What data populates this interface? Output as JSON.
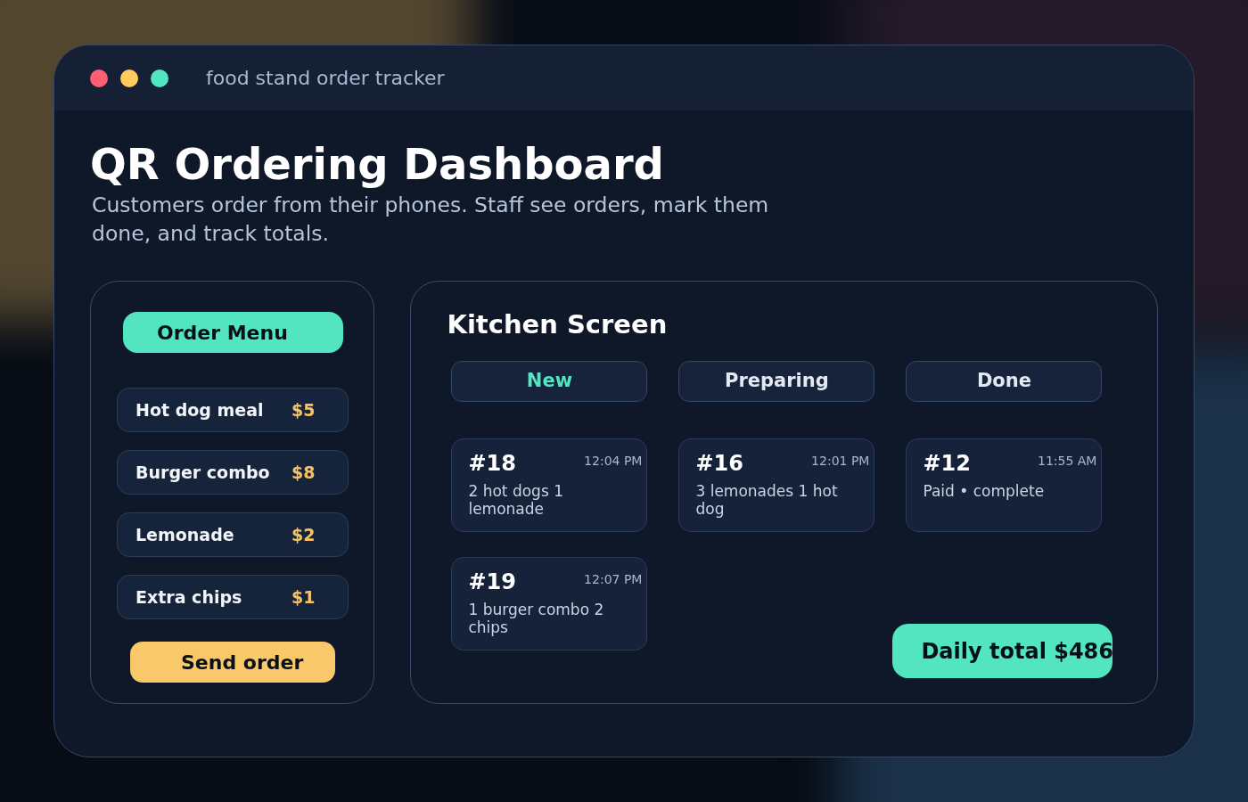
{
  "window": {
    "title": "food stand order tracker"
  },
  "header": {
    "title": "QR Ordering Dashboard",
    "subtitle": "Customers order from their phones. Staff see orders, mark them done, and track totals."
  },
  "order_menu": {
    "title": "Order Menu",
    "items": [
      {
        "name": "Hot dog meal",
        "price": "$5"
      },
      {
        "name": "Burger combo",
        "price": "$8"
      },
      {
        "name": "Lemonade",
        "price": "$2"
      },
      {
        "name": "Extra chips",
        "price": "$1"
      }
    ],
    "button": "Send order"
  },
  "kitchen": {
    "title": "Kitchen Screen",
    "columns": [
      {
        "label": "New",
        "selected": true,
        "orders": [
          {
            "number": "#18",
            "time": "12:04 PM",
            "details": "2 hot dogs 1 lemonade"
          },
          {
            "number": "#19",
            "time": "12:07 PM",
            "details": "1 burger combo 2 chips"
          }
        ]
      },
      {
        "label": "Preparing",
        "selected": false,
        "orders": [
          {
            "number": "#16",
            "time": "12:01 PM",
            "details": "3 lemonades 1 hot dog"
          }
        ]
      },
      {
        "label": "Done",
        "selected": false,
        "orders": [
          {
            "number": "#12",
            "time": "11:55 AM",
            "details": "Paid • complete"
          }
        ]
      }
    ],
    "daily_total": "Daily total $486"
  }
}
